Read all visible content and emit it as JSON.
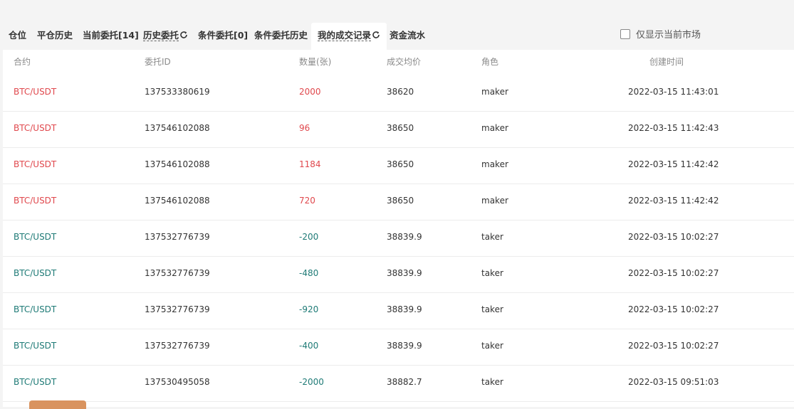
{
  "tabs": [
    {
      "label": "仓位",
      "name": "tab-positions"
    },
    {
      "label": "平仓历史",
      "name": "tab-close-history"
    },
    {
      "label": "当前委托[14]",
      "name": "tab-open-orders"
    },
    {
      "label": "历史委托",
      "name": "tab-order-history"
    },
    {
      "label": "条件委托[0]",
      "name": "tab-conditional-orders"
    },
    {
      "label": "条件委托历史",
      "name": "tab-conditional-history"
    },
    {
      "label": "我的成交记录",
      "name": "tab-my-trades"
    },
    {
      "label": "资金流水",
      "name": "tab-fund-flow"
    }
  ],
  "filter": {
    "label": "仅显示当前市场",
    "checked": false
  },
  "table": {
    "headers": {
      "contract": "合约",
      "order_id": "委托ID",
      "qty": "数量(张)",
      "avg_price": "成交均价",
      "role": "角色",
      "created": "创建时间"
    },
    "rows": [
      {
        "contract": "BTC/USDT",
        "order_id": "137533380619",
        "qty": "2000",
        "avg_price": "38620",
        "role": "maker",
        "created": "2022-03-15 11:43:01",
        "side": "buy"
      },
      {
        "contract": "BTC/USDT",
        "order_id": "137546102088",
        "qty": "96",
        "avg_price": "38650",
        "role": "maker",
        "created": "2022-03-15 11:42:43",
        "side": "buy"
      },
      {
        "contract": "BTC/USDT",
        "order_id": "137546102088",
        "qty": "1184",
        "avg_price": "38650",
        "role": "maker",
        "created": "2022-03-15 11:42:42",
        "side": "buy"
      },
      {
        "contract": "BTC/USDT",
        "order_id": "137546102088",
        "qty": "720",
        "avg_price": "38650",
        "role": "maker",
        "created": "2022-03-15 11:42:42",
        "side": "buy"
      },
      {
        "contract": "BTC/USDT",
        "order_id": "137532776739",
        "qty": "-200",
        "avg_price": "38839.9",
        "role": "taker",
        "created": "2022-03-15 10:02:27",
        "side": "sell"
      },
      {
        "contract": "BTC/USDT",
        "order_id": "137532776739",
        "qty": "-480",
        "avg_price": "38839.9",
        "role": "taker",
        "created": "2022-03-15 10:02:27",
        "side": "sell"
      },
      {
        "contract": "BTC/USDT",
        "order_id": "137532776739",
        "qty": "-920",
        "avg_price": "38839.9",
        "role": "taker",
        "created": "2022-03-15 10:02:27",
        "side": "sell"
      },
      {
        "contract": "BTC/USDT",
        "order_id": "137532776739",
        "qty": "-400",
        "avg_price": "38839.9",
        "role": "taker",
        "created": "2022-03-15 10:02:27",
        "side": "sell"
      },
      {
        "contract": "BTC/USDT",
        "order_id": "137530495058",
        "qty": "-2000",
        "avg_price": "38882.7",
        "role": "taker",
        "created": "2022-03-15 09:51:03",
        "side": "sell"
      }
    ]
  },
  "colors": {
    "buy": "#e0484d",
    "sell": "#1e7a76",
    "accent_button": "#d9935f"
  },
  "icons": {
    "refresh": "refresh-icon",
    "checkbox": "checkbox-icon"
  }
}
